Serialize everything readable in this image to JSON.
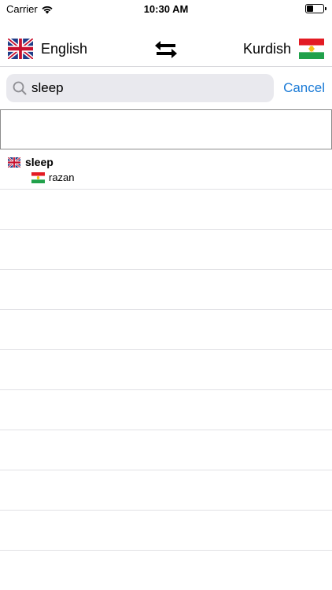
{
  "status_bar": {
    "carrier": "Carrier",
    "time": "10:30 AM",
    "battery_level": 0.4
  },
  "language_bar": {
    "source_language": "English",
    "target_language": "Kurdish",
    "source_flag_icon": "uk-flag-icon",
    "target_flag_icon": "kurdistan-flag-icon",
    "swap_icon": "swap-arrows-icon"
  },
  "search": {
    "value": "sleep",
    "cancel_label": "Cancel",
    "icon": "search-icon"
  },
  "results": [
    {
      "source_word": "sleep",
      "translation": "razan"
    }
  ],
  "colors": {
    "accent": "#1a7ad6",
    "search_bg": "#e9e9ee",
    "flag_red": "#e31b23",
    "flag_green": "#21a14b",
    "flag_sun": "#f6c118",
    "uk_blue": "#1f3c88"
  }
}
